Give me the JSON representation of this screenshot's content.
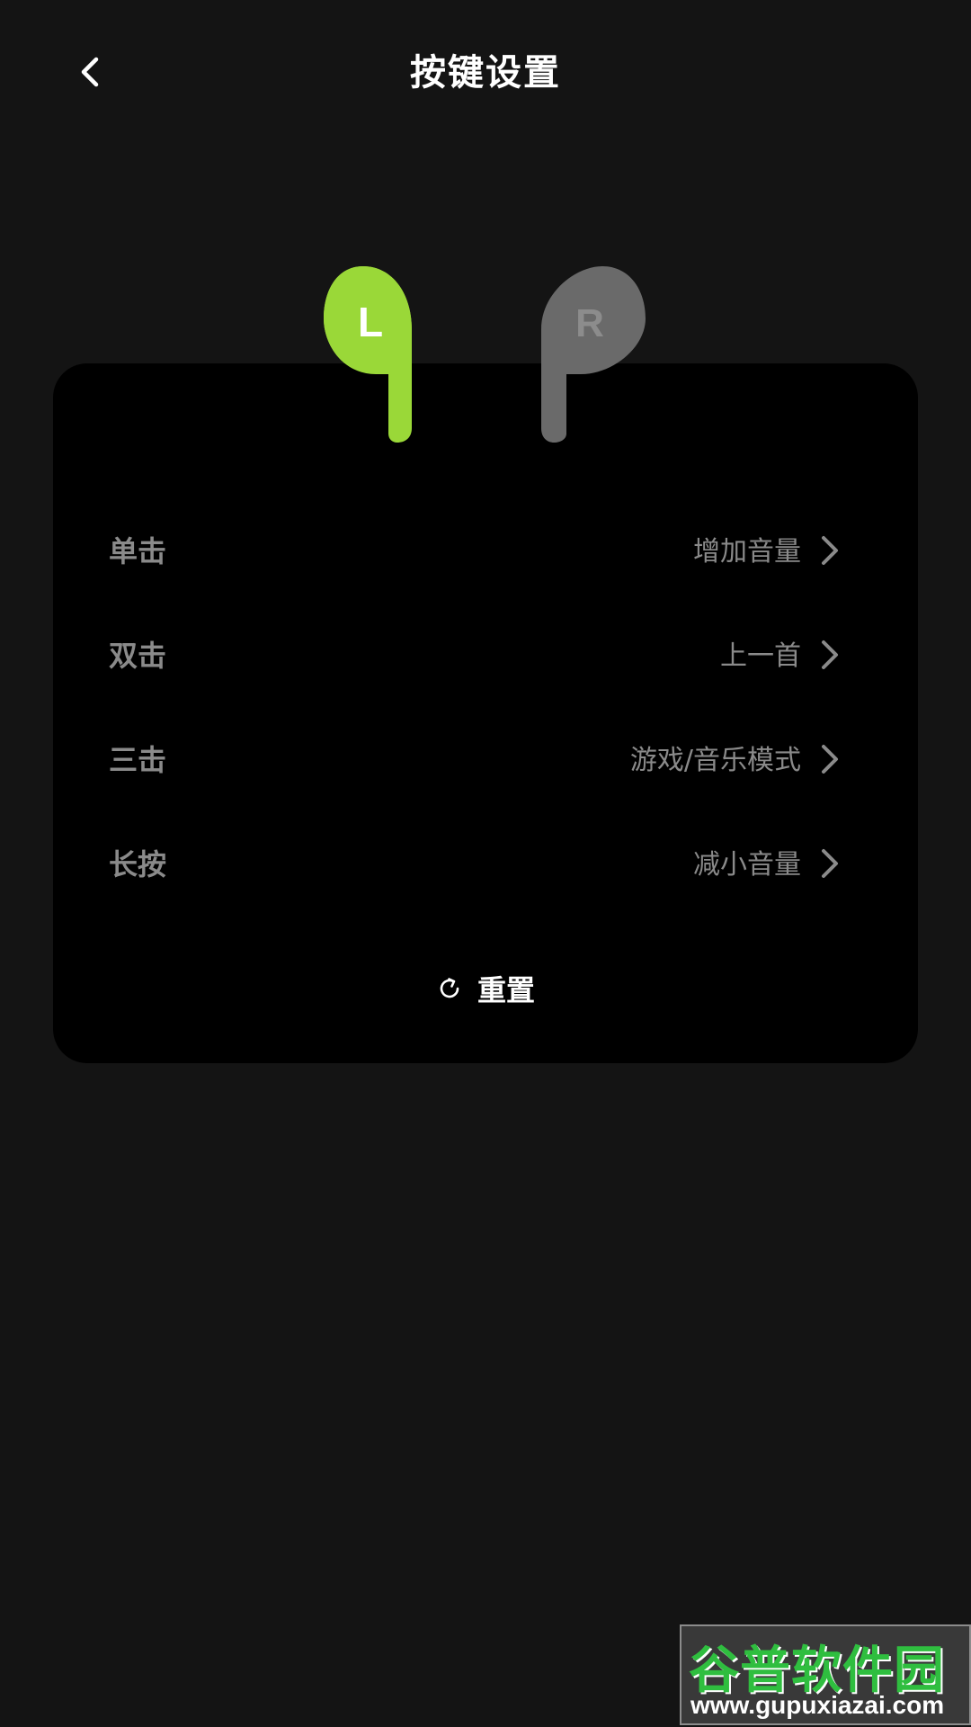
{
  "header": {
    "title": "按键设置",
    "back_icon": "chevron-left-icon"
  },
  "earbuds": {
    "left": {
      "letter": "L",
      "color": "#9ad838",
      "selected": true
    },
    "right": {
      "letter": "R",
      "color": "#6a6a6a",
      "selected": false
    }
  },
  "settings": {
    "rows": [
      {
        "label": "单击",
        "value": "增加音量"
      },
      {
        "label": "双击",
        "value": "上一首"
      },
      {
        "label": "三击",
        "value": "游戏/音乐模式"
      },
      {
        "label": "长按",
        "value": "减小音量"
      }
    ],
    "reset_label": "重置",
    "reset_icon": "refresh-icon"
  },
  "watermark": {
    "brand": "谷普软件园",
    "url": "www.gupuxiazai.com"
  },
  "colors": {
    "background": "#141414",
    "card": "#000000",
    "accent": "#9ad838",
    "muted_text": "#8a8a8a"
  }
}
